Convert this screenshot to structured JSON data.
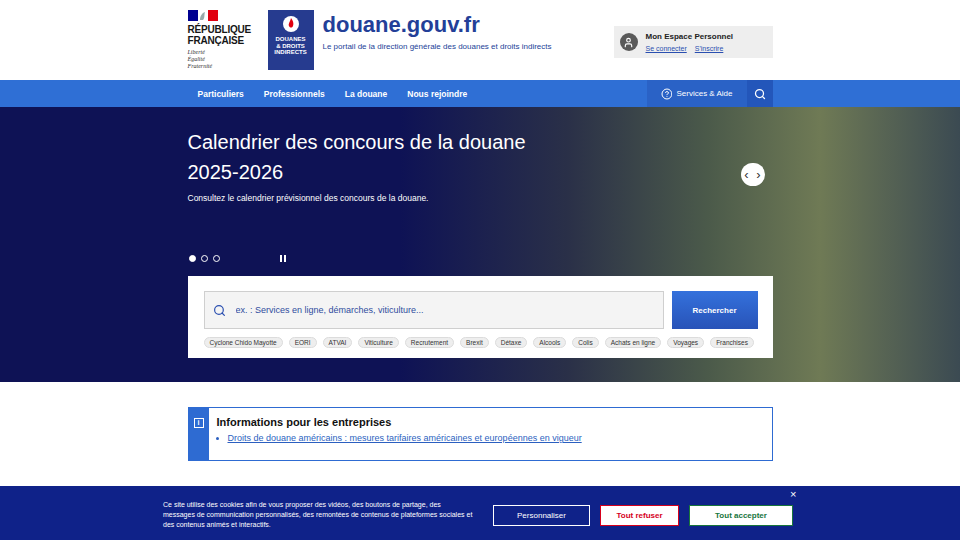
{
  "header": {
    "republic_lines": [
      "RÉPUBLIQUE",
      "FRANÇAISE"
    ],
    "motto_lines": [
      "Liberté",
      "Égalité",
      "Fraternité"
    ],
    "logo_lines": [
      "DOUANES",
      "& DROITS",
      "INDIRECTS"
    ],
    "site_name": "douane.gouv.fr",
    "tagline": "Le portail de la direction générale des douanes et droits indirects"
  },
  "account": {
    "title": "Mon Espace Personnel",
    "links": [
      "Se connecter",
      "S'inscrire"
    ]
  },
  "nav": {
    "items": [
      "Particuliers",
      "Professionnels",
      "La douane",
      "Nous rejoindre"
    ],
    "help": "Services & Aide"
  },
  "hero": {
    "title_lines": [
      "Calendrier des concours de la douane",
      "2025-2026"
    ],
    "subtitle": "Consultez le calendrier prévisionnel des concours de la douane.",
    "slides": [
      {
        "selected": true
      },
      {
        "selected": false
      },
      {
        "selected": false
      }
    ],
    "playing": true,
    "arrows": [
      "‹",
      "›"
    ]
  },
  "search": {
    "placeholder": "ex. : Services en ligne, démarches, viticulture...",
    "button": "Rechercher",
    "tags": [
      "Cyclone Chido Mayotte",
      "EORI",
      "ATVAI",
      "Viticulture",
      "Recrutement",
      "Brexit",
      "Détaxe",
      "Alcools",
      "Colis",
      "Achats en ligne",
      "Voyages",
      "Franchises"
    ]
  },
  "notice": {
    "icon": "i",
    "title": "Informations pour les entreprises",
    "links": [
      "Droits de douane américains : mesures tarifaires américaines et européennes en vigueur"
    ]
  },
  "cookies": {
    "text": "Ce site utilise des cookies afin de vous proposer des vidéos, des boutons de partage, des messages de communication personnalisés, des remontées de contenus de plateformes sociales et des contenus animés et interactifs.",
    "buttons": [
      {
        "label": "Personnaliser",
        "kind": "outline"
      },
      {
        "label": "Tout refuser",
        "kind": "refuse"
      },
      {
        "label": "Tout accepter",
        "kind": "accept"
      }
    ],
    "close": "×"
  }
}
